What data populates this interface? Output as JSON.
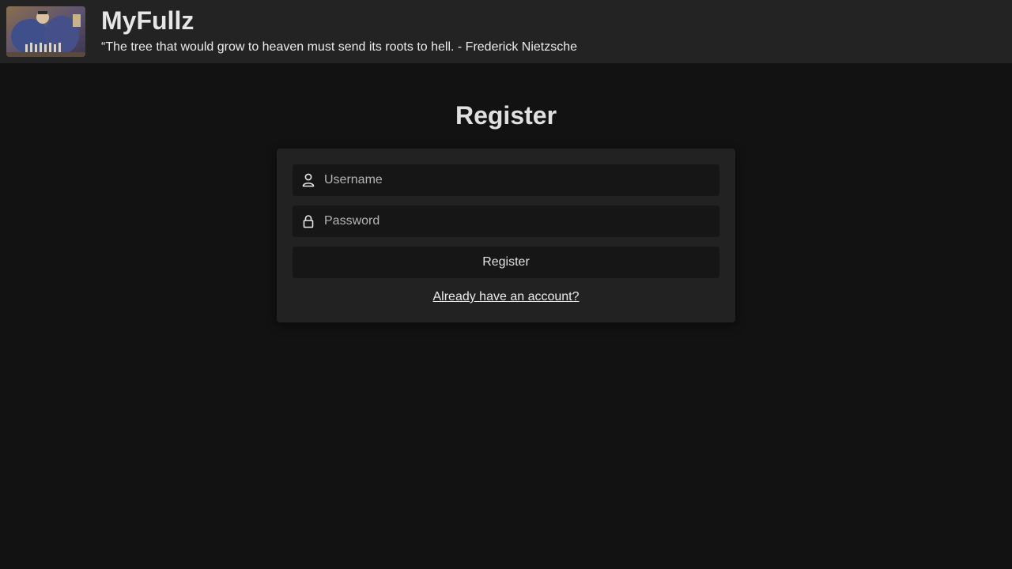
{
  "header": {
    "site_title": "MyFullz",
    "tagline": "“The tree that would grow to heaven must send its roots to hell. - Frederick Nietzsche",
    "logo_icon": "painting-thumbnail"
  },
  "page": {
    "title": "Register"
  },
  "form": {
    "username": {
      "icon": "user-icon",
      "value": "",
      "placeholder": "Username"
    },
    "password": {
      "icon": "lock-icon",
      "value": "",
      "placeholder": "Password"
    },
    "submit_label": "Register",
    "login_link": "Already have an account?"
  },
  "colors": {
    "background": "#121212",
    "header": "#232323",
    "card": "#222222",
    "input": "#161616",
    "text": "#e8e8e8"
  }
}
